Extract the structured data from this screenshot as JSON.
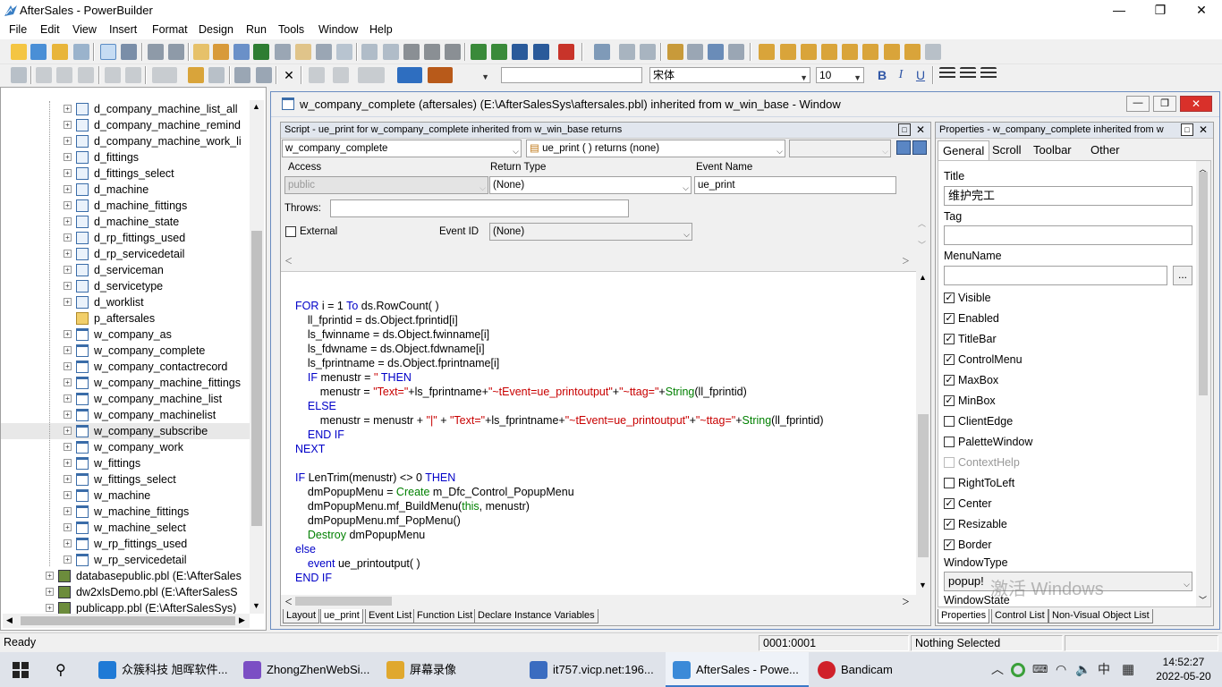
{
  "app": {
    "title": "AfterSales - PowerBuilder"
  },
  "window_controls": {
    "minimize": "—",
    "maximize": "❐",
    "close": "✕"
  },
  "menu": [
    "File",
    "Edit",
    "View",
    "Insert",
    "Format",
    "Design",
    "Run",
    "Tools",
    "Window",
    "Help"
  ],
  "format_toolbar": {
    "font_name": "宋体",
    "font_size": "10",
    "bold": "B",
    "italic": "I",
    "underline": "U"
  },
  "tree": {
    "items": [
      {
        "label": "d_company_machine_list_all",
        "type": "dw",
        "level": 2
      },
      {
        "label": "d_company_machine_remind",
        "type": "dw",
        "level": 2
      },
      {
        "label": "d_company_machine_work_li",
        "type": "dw",
        "level": 2
      },
      {
        "label": "d_fittings",
        "type": "dw",
        "level": 2
      },
      {
        "label": "d_fittings_select",
        "type": "dw",
        "level": 2
      },
      {
        "label": "d_machine",
        "type": "dw",
        "level": 2
      },
      {
        "label": "d_machine_fittings",
        "type": "dw",
        "level": 2
      },
      {
        "label": "d_machine_state",
        "type": "dw",
        "level": 2
      },
      {
        "label": "d_rp_fittings_used",
        "type": "dw",
        "level": 2
      },
      {
        "label": "d_rp_servicedetail",
        "type": "dw",
        "level": 2
      },
      {
        "label": "d_serviceman",
        "type": "dw",
        "level": 2
      },
      {
        "label": "d_servicetype",
        "type": "dw",
        "level": 2
      },
      {
        "label": "d_worklist",
        "type": "dw",
        "level": 2
      },
      {
        "label": "p_aftersales",
        "type": "folder",
        "level": 2
      },
      {
        "label": "w_company_as",
        "type": "win",
        "level": 2
      },
      {
        "label": "w_company_complete",
        "type": "win",
        "level": 2
      },
      {
        "label": "w_company_contactrecord",
        "type": "win",
        "level": 2
      },
      {
        "label": "w_company_machine_fittings",
        "type": "win",
        "level": 2
      },
      {
        "label": "w_company_machine_list",
        "type": "win",
        "level": 2
      },
      {
        "label": "w_company_machinelist",
        "type": "win",
        "level": 2
      },
      {
        "label": "w_company_subscribe",
        "type": "win",
        "level": 2
      },
      {
        "label": "w_company_work",
        "type": "win",
        "level": 2
      },
      {
        "label": "w_fittings",
        "type": "win",
        "level": 2
      },
      {
        "label": "w_fittings_select",
        "type": "win",
        "level": 2
      },
      {
        "label": "w_machine",
        "type": "win",
        "level": 2
      },
      {
        "label": "w_machine_fittings",
        "type": "win",
        "level": 2
      },
      {
        "label": "w_machine_select",
        "type": "win",
        "level": 2
      },
      {
        "label": "w_rp_fittings_used",
        "type": "win",
        "level": 2
      },
      {
        "label": "w_rp_servicedetail",
        "type": "win",
        "level": 2
      },
      {
        "label": "databasepublic.pbl (E:\\AfterSales",
        "type": "pbl",
        "level": 1
      },
      {
        "label": "dw2xlsDemo.pbl (E:\\AfterSalesS",
        "type": "pbl",
        "level": 1
      },
      {
        "label": "publicapp.pbl (E:\\AfterSalesSys)",
        "type": "pbl",
        "level": 1
      }
    ]
  },
  "main_window": {
    "title": "w_company_complete (aftersales) (E:\\AfterSalesSys\\aftersales.pbl) inherited from w_win_base - Window"
  },
  "script": {
    "pane_title": "Script - ue_print for w_company_complete inherited from w_win_base returns",
    "object_select": "w_company_complete",
    "event_select": "ue_print ( ) returns (none)",
    "access_label": "Access",
    "access_value": "public",
    "return_type_label": "Return Type",
    "return_type_value": "(None)",
    "event_name_label": "Event Name",
    "event_name_value": "ue_print",
    "throws_label": "Throws:",
    "external_label": "External",
    "event_id_label": "Event ID",
    "event_id_value": "(None)"
  },
  "code": [
    "FOR i = 1 To ds.RowCount( )",
    "    ll_fprintid = ds.Object.fprintid[i]",
    "    ls_fwinname = ds.Object.fwinname[i]",
    "    ls_fdwname = ds.Object.fdwname[i]",
    "    ls_fprintname = ds.Object.fprintname[i]",
    "    IF menustr = '' THEN",
    "        menustr = \"Text=\"+ls_fprintname+\"~tEvent=ue_printoutput\"+\"~ttag=\"+String(ll_fprintid)",
    "    ELSE",
    "        menustr = menustr + \"|\" + \"Text=\"+ls_fprintname+\"~tEvent=ue_printoutput\"+\"~ttag=\"+String(ll_fprintid)",
    "    END IF",
    "NEXT",
    "",
    "IF LenTrim(menustr) <> 0 THEN",
    "    dmPopupMenu = Create m_Dfc_Control_PopupMenu",
    "    dmPopupMenu.mf_BuildMenu(this, menustr)",
    "    dmPopupMenu.mf_PopMenu()",
    "    Destroy dmPopupMenu",
    "else",
    "    event ue_printoutput( )",
    "END IF"
  ],
  "script_tabs": [
    "Layout",
    "ue_print",
    "Event List",
    "Function List",
    "Declare Instance Variables"
  ],
  "properties": {
    "pane_title": "Properties - w_company_complete  inherited  from  w",
    "tabs": [
      "General",
      "Scroll",
      "Toolbar",
      "Other"
    ],
    "title_label": "Title",
    "title_value": "维护完工",
    "tag_label": "Tag",
    "tag_value": "",
    "menuname_label": "MenuName",
    "menuname_value": "",
    "browse_button": "...",
    "checkboxes": [
      {
        "label": "Visible",
        "checked": true
      },
      {
        "label": "Enabled",
        "checked": true
      },
      {
        "label": "TitleBar",
        "checked": true
      },
      {
        "label": "ControlMenu",
        "checked": true
      },
      {
        "label": "MaxBox",
        "checked": true
      },
      {
        "label": "MinBox",
        "checked": true
      },
      {
        "label": "ClientEdge",
        "checked": false
      },
      {
        "label": "PaletteWindow",
        "checked": false
      },
      {
        "label": "ContextHelp",
        "checked": false,
        "disabled": true
      },
      {
        "label": "RightToLeft",
        "checked": false
      },
      {
        "label": "Center",
        "checked": true
      },
      {
        "label": "Resizable",
        "checked": true
      },
      {
        "label": "Border",
        "checked": true
      }
    ],
    "windowtype_label": "WindowType",
    "windowtype_value": "popup!",
    "windowstate_label": "WindowState",
    "watermark": "激活 Windows",
    "bottom_tabs": [
      "Properties",
      "Control List",
      "Non-Visual Object List"
    ]
  },
  "status": {
    "ready": "Ready",
    "position": "0001:0001",
    "selection": "Nothing Selected"
  },
  "taskbar": {
    "items": [
      {
        "label": "众簇科技 旭晖软件...",
        "color": "#1f7ad6"
      },
      {
        "label": "ZhongZhenWebSi...",
        "color": "#7b4fc4"
      },
      {
        "label": "屏幕录像",
        "color": "#e0a82e"
      },
      {
        "label": "it757.vicp.net:196...",
        "color": "#3a6cc0"
      },
      {
        "label": "AfterSales - Powe...",
        "color": "#3b8ad8"
      },
      {
        "label": "Bandicam",
        "color": "#d0202a"
      }
    ],
    "ime": "中",
    "clock_time": "14:52:27",
    "clock_date": "2022-05-20"
  }
}
